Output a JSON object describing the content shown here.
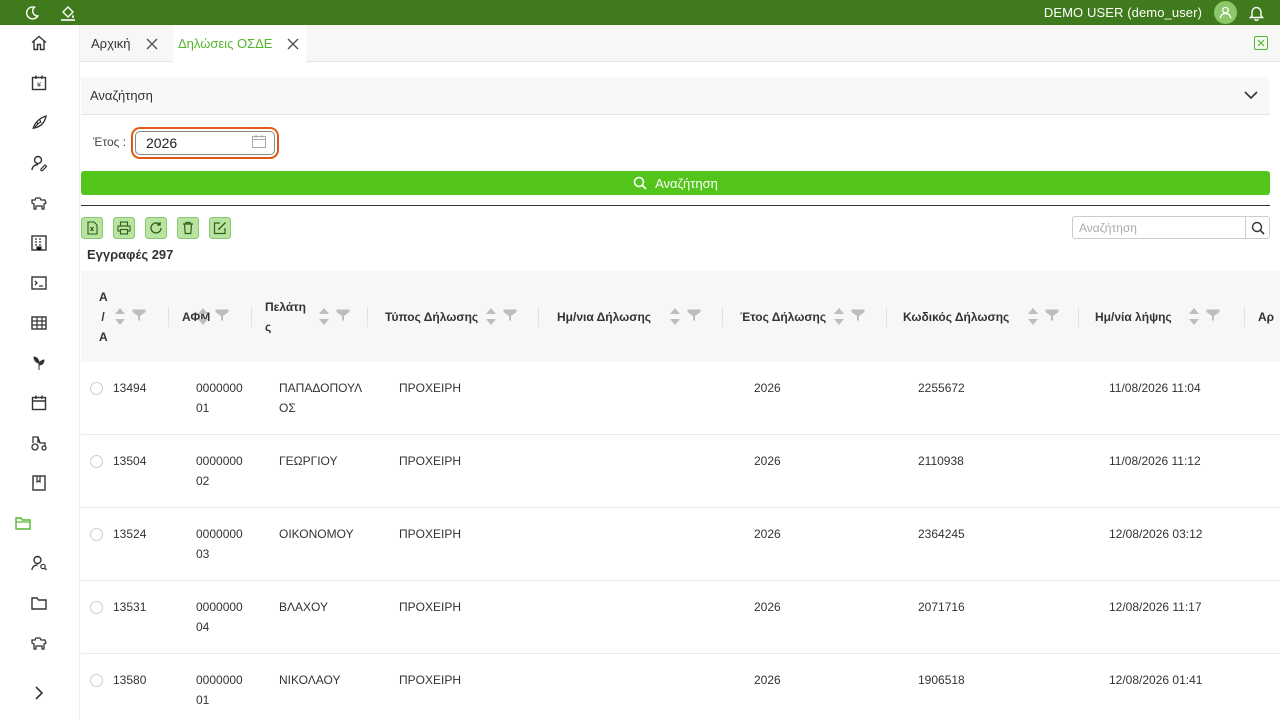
{
  "topbar": {
    "user_label": "DEMO USER (demo_user)",
    "icons": [
      "moon-icon",
      "paint-bucket-icon",
      "user-avatar-icon",
      "bell-icon"
    ],
    "background": "#3f7a1c"
  },
  "sidebar": {
    "items": [
      {
        "icon": "home-icon"
      },
      {
        "icon": "calendar-money-icon"
      },
      {
        "icon": "crop-leaf-icon"
      },
      {
        "icon": "user-edit-icon"
      },
      {
        "icon": "cow-icon"
      },
      {
        "icon": "building-icon"
      },
      {
        "icon": "terminal-icon"
      },
      {
        "icon": "table-icon"
      },
      {
        "icon": "sprout-icon"
      },
      {
        "icon": "calendar-icon"
      },
      {
        "icon": "tractor-icon"
      },
      {
        "icon": "book-icon"
      },
      {
        "icon": "folder-open-icon",
        "active": true
      },
      {
        "icon": "user-search-icon"
      },
      {
        "icon": "folder-icon"
      },
      {
        "icon": "cow-icon"
      },
      {
        "icon": "chevron-right-icon"
      }
    ],
    "active_color": "#52b72c"
  },
  "tabs": [
    {
      "label": "Αρχική",
      "active": false
    },
    {
      "label": "Δηλώσεις ΟΣΔΕ",
      "active": true
    }
  ],
  "search_panel": {
    "title": "Αναζήτηση",
    "year_label": "Έτος :",
    "year_value": "2026",
    "search_button": "Αναζήτηση"
  },
  "toolbar": {
    "buttons": [
      "excel-icon",
      "print-icon",
      "refresh-icon",
      "delete-icon",
      "edit-icon"
    ],
    "records_label": "Εγγραφές 297",
    "search_placeholder": "Αναζήτηση"
  },
  "table": {
    "columns": [
      {
        "label": "Α / Α"
      },
      {
        "label": "ΑΦΜ"
      },
      {
        "label": "Πελάτης"
      },
      {
        "label": "Τύπος Δήλωσης"
      },
      {
        "label": "Ημ/νια Δήλωσης"
      },
      {
        "label": "Έτος Δήλωσης"
      },
      {
        "label": "Κωδικός Δήλωσης"
      },
      {
        "label": "Ημ/νία λήψης"
      },
      {
        "label": "Αρ"
      }
    ],
    "rows": [
      {
        "aa": "13494",
        "afm": "000000001",
        "client": "ΠΑΠΑΔΟΠΟΥΛΟΣ",
        "type": "ΠΡΟΧΕΙΡΗ",
        "date": "",
        "year": "2026",
        "code": "2255672",
        "received": "11/08/2026 11:04"
      },
      {
        "aa": "13504",
        "afm": "000000002",
        "client": "ΓΕΩΡΓΙΟΥ",
        "type": "ΠΡΟΧΕΙΡΗ",
        "date": "",
        "year": "2026",
        "code": "2110938",
        "received": "11/08/2026 11:12"
      },
      {
        "aa": "13524",
        "afm": "000000003",
        "client": "ΟΙΚΟΝΟΜΟΥ",
        "type": "ΠΡΟΧΕΙΡΗ",
        "date": "",
        "year": "2026",
        "code": "2364245",
        "received": "12/08/2026 03:12"
      },
      {
        "aa": "13531",
        "afm": "000000004",
        "client": "ΒΛΑΧΟΥ",
        "type": "ΠΡΟΧΕΙΡΗ",
        "date": "",
        "year": "2026",
        "code": "2071716",
        "received": "12/08/2026 11:17"
      },
      {
        "aa": "13580",
        "afm": "000000001",
        "client": "ΝΙΚΟΛΑΟΥ",
        "type": "ΠΡΟΧΕΙΡΗ",
        "date": "",
        "year": "2026",
        "code": "1906518",
        "received": "12/08/2026 01:41"
      }
    ]
  },
  "colors": {
    "accent_green": "#52c41a",
    "highlight_orange": "#e05a14",
    "tool_button": "#b9e3a3"
  }
}
